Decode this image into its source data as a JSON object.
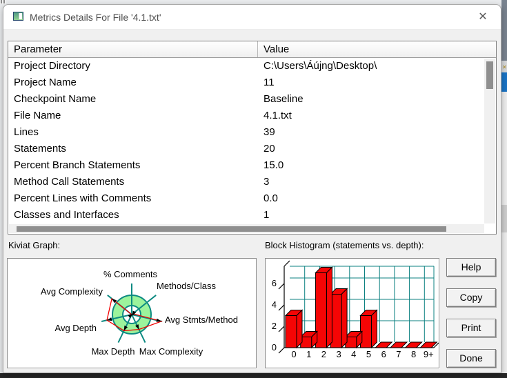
{
  "window": {
    "title": "Metrics Details For File '4.1.txt'",
    "close_glyph": "✕"
  },
  "table": {
    "headers": [
      "Parameter",
      "Value"
    ],
    "rows": [
      {
        "param": "Project Directory",
        "value": "C:\\Users\\Áújng\\Desktop\\"
      },
      {
        "param": "Project Name",
        "value": "11"
      },
      {
        "param": "Checkpoint Name",
        "value": "Baseline"
      },
      {
        "param": "File Name",
        "value": "4.1.txt"
      },
      {
        "param": "Lines",
        "value": "39"
      },
      {
        "param": "Statements",
        "value": "20"
      },
      {
        "param": "Percent Branch Statements",
        "value": "15.0"
      },
      {
        "param": "Method Call Statements",
        "value": "3"
      },
      {
        "param": "Percent Lines with Comments",
        "value": "0.0"
      },
      {
        "param": "Classes and Interfaces",
        "value": "1"
      }
    ]
  },
  "sections": {
    "kiviat_label": "Kiviat Graph:",
    "histogram_label": "Block Histogram (statements vs. depth):"
  },
  "buttons": {
    "help": "Help",
    "copy": "Copy",
    "print": "Print",
    "done": "Done"
  },
  "chart_data": [
    {
      "type": "radar",
      "title": "Kiviat Graph",
      "axes": [
        "% Comments",
        "Methods/Class",
        "Avg Stmts/Method",
        "Max Complexity",
        "Max Depth",
        "Avg Depth",
        "Avg Complexity"
      ],
      "values_norm": [
        0.0,
        0.045,
        1.0,
        0.545,
        0.59,
        0.84,
        0.84
      ],
      "ring": {
        "inner_norm": 0.3,
        "outer_norm": 0.64
      },
      "colors": {
        "ring_fill": "#9cf39c",
        "spokes": "#0d8a82",
        "data_line": "#f40000",
        "markers": "#000000"
      }
    },
    {
      "type": "bar",
      "title": "Block Histogram (statements vs. depth)",
      "categories": [
        "0",
        "1",
        "2",
        "3",
        "4",
        "5",
        "6",
        "7",
        "8",
        "9+"
      ],
      "values": [
        3,
        1,
        7,
        5,
        1,
        3,
        0,
        0,
        0,
        0
      ],
      "yticks": [
        0,
        2,
        4,
        6
      ],
      "ylim": [
        0,
        7.5
      ],
      "style": "3d",
      "colors": {
        "bar": "#f50505",
        "grid": "#0b8080",
        "axis": "#000000"
      }
    }
  ],
  "colors": {
    "dialog_bg": "#f0f0f0",
    "titlebar_bg": "#ffffff",
    "backdrop_blue": "#1a73c4"
  }
}
